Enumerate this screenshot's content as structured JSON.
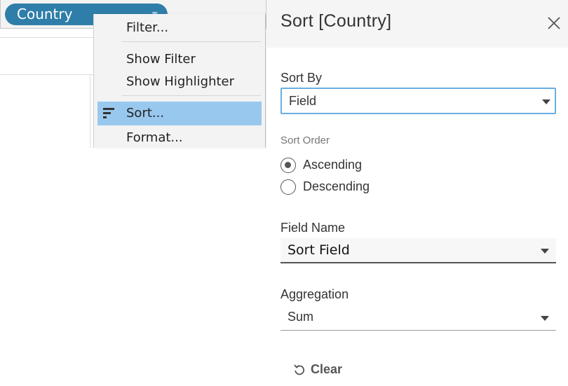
{
  "shelf": {
    "pill_label": "Country",
    "pill_color": "#2f7ea9"
  },
  "context_menu": {
    "items": [
      {
        "label": "Filter...",
        "icon": ""
      },
      {
        "label": "Show Filter",
        "icon": ""
      },
      {
        "label": "Show Highlighter",
        "icon": ""
      },
      {
        "label": "Sort...",
        "icon": "sort-icon",
        "highlighted": true
      },
      {
        "label": "Format...",
        "icon": ""
      }
    ],
    "highlight_color": "#99c8ee"
  },
  "dialog": {
    "title": "Sort [Country]",
    "close_icon": "close-icon",
    "sort_by": {
      "label": "Sort By",
      "value": "Field",
      "focus_color": "#6aaee0"
    },
    "sort_order": {
      "label": "Sort Order",
      "options": [
        {
          "label": "Ascending",
          "selected": true
        },
        {
          "label": "Descending",
          "selected": false
        }
      ]
    },
    "field_name": {
      "label": "Field Name",
      "value": "Sort Field"
    },
    "aggregation": {
      "label": "Aggregation",
      "value": "Sum"
    },
    "clear": {
      "label": "Clear",
      "icon": "undo-icon"
    }
  }
}
